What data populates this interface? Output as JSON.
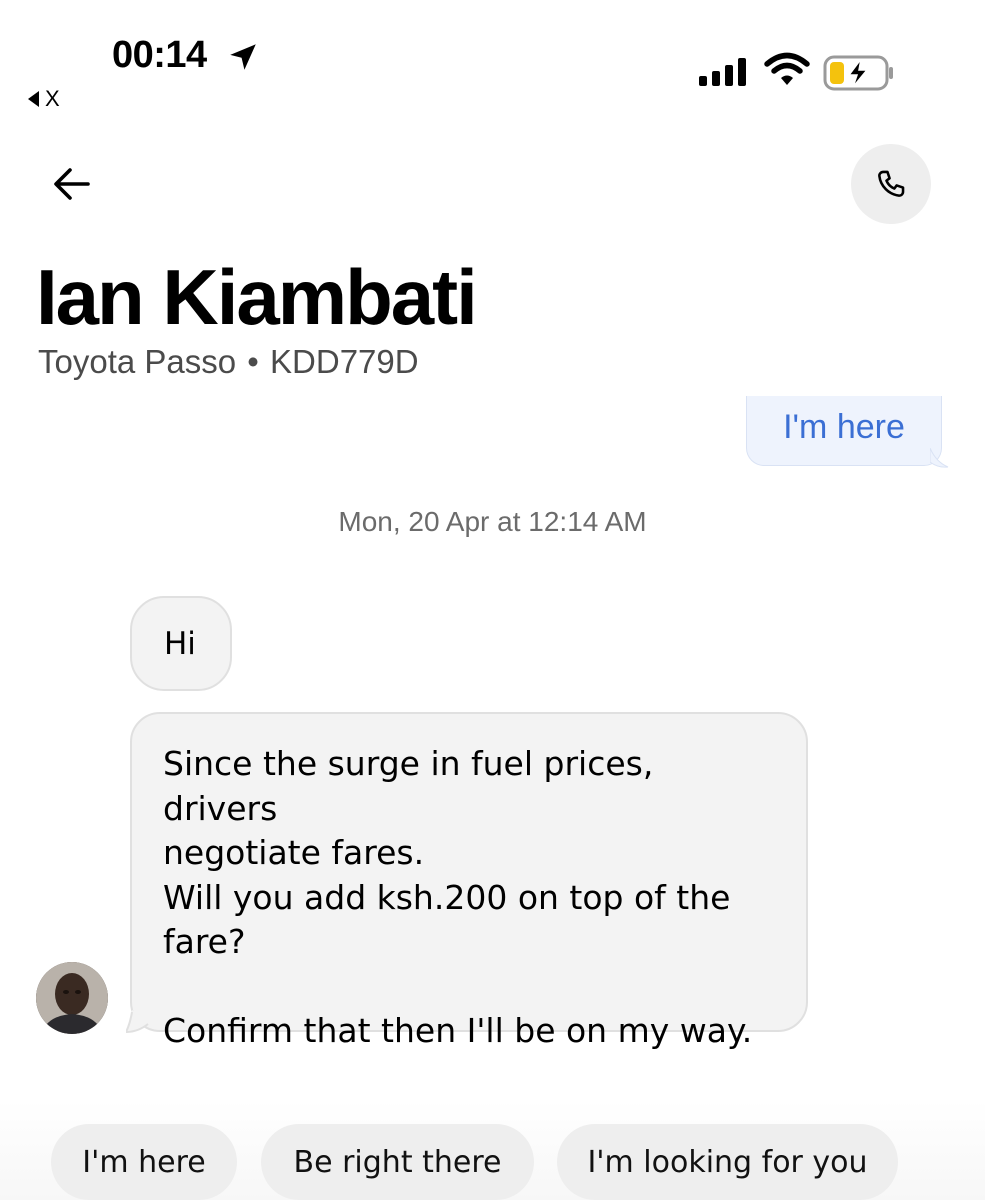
{
  "status_bar": {
    "time": "00:14",
    "back_app_label": "X",
    "battery_color": "#f4c20d",
    "icons": [
      "location-arrow-icon",
      "cellular-signal-icon",
      "wifi-icon",
      "battery-charging-icon"
    ]
  },
  "header": {
    "back_icon": "arrow-left-icon",
    "call_icon": "phone-icon",
    "driver_name": "Ian Kiambati",
    "vehicle_model": "Toyota Passo",
    "separator": "•",
    "plate": "KDD779D"
  },
  "messages": {
    "sent": [
      {
        "text": "I'm here"
      }
    ],
    "timestamp": "Mon, 20 Apr at 12:14 AM",
    "received": [
      {
        "text": "Hi"
      },
      {
        "lines": [
          "Since the surge in fuel prices, drivers",
          "negotiate fares.",
          "Will you add ksh.200 on top of the",
          "fare?",
          "",
          "Confirm that then I'll be on my way."
        ]
      }
    ]
  },
  "quick_replies": [
    {
      "label": "I'm here"
    },
    {
      "label": "Be right there"
    },
    {
      "label": "I'm looking for you"
    }
  ],
  "colors": {
    "sent_bubble_bg": "#eef3fd",
    "sent_text": "#3b6fd4",
    "received_bubble_bg": "#f3f3f3",
    "chip_bg": "#eeeeee"
  }
}
